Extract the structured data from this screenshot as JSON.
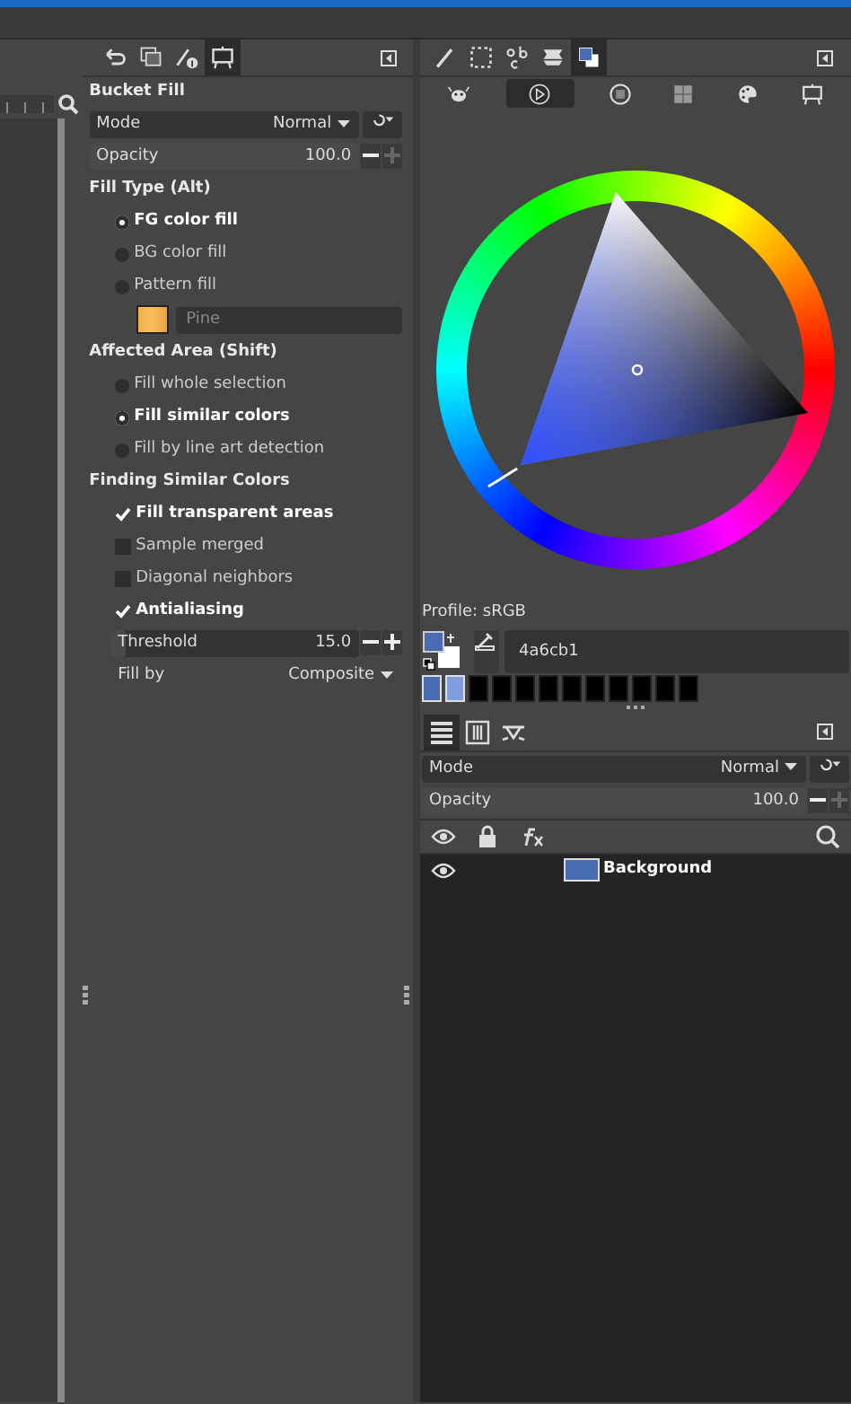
{
  "left_dock": {
    "tabs": [
      {
        "kind": "undo",
        "selected": false
      },
      {
        "kind": "images",
        "selected": false
      },
      {
        "kind": "pointer",
        "selected": false
      },
      {
        "kind": "device",
        "selected": true
      }
    ]
  },
  "tool_options": {
    "title": "Bucket Fill",
    "mode": {
      "label": "Mode",
      "value": "Normal"
    },
    "opacity": {
      "label": "Opacity",
      "value": "100.0",
      "level": 1
    },
    "fill_type": {
      "title": "Fill Type  (Alt)",
      "options": [
        {
          "label": "FG color fill",
          "selected": true
        },
        {
          "label": "BG color fill",
          "selected": false
        },
        {
          "label": "Pattern fill",
          "selected": false
        }
      ]
    },
    "pattern": {
      "name": "Pine"
    },
    "affected_area": {
      "title": "Affected Area  (Shift)",
      "options": [
        {
          "label": "Fill whole selection",
          "selected": false
        },
        {
          "label": "Fill similar colors",
          "selected": true
        },
        {
          "label": "Fill by line art detection",
          "selected": false
        }
      ]
    },
    "similar_colors": {
      "title": "Finding Similar Colors",
      "checks": [
        {
          "label": "Fill transparent areas",
          "checked": true
        },
        {
          "label": "Sample merged",
          "checked": false
        },
        {
          "label": "Diagonal neighbors",
          "checked": false
        },
        {
          "label": "Antialiasing",
          "checked": true
        }
      ]
    },
    "threshold": {
      "label": "Threshold",
      "value": "15.0",
      "level": 0.06
    },
    "fill_by": {
      "label": "Fill by",
      "value": "Composite"
    }
  },
  "right_dock": {
    "tabs": [
      {
        "kind": "brush",
        "selected": false
      },
      {
        "kind": "selection",
        "selected": false
      },
      {
        "kind": "fonts",
        "selected": false
      },
      {
        "kind": "patterns",
        "selected": false
      },
      {
        "kind": "colors",
        "selected": true
      }
    ],
    "color_tabs": [
      {
        "kind": "gimp",
        "selected": false
      },
      {
        "kind": "wheel",
        "selected": true
      },
      {
        "kind": "scales",
        "selected": false
      },
      {
        "kind": "cmyk",
        "selected": false
      },
      {
        "kind": "palette",
        "selected": false
      },
      {
        "kind": "device",
        "selected": false
      }
    ],
    "profile": "Profile: sRGB",
    "hex": "4a6cb1",
    "history": [
      {
        "color": "#4a6cb1"
      },
      {
        "color": "#7f9ee0"
      },
      {
        "color": "#000000"
      },
      {
        "color": "#000000"
      },
      {
        "color": "#000000"
      },
      {
        "color": "#000000"
      },
      {
        "color": "#000000"
      },
      {
        "color": "#000000"
      },
      {
        "color": "#000000"
      },
      {
        "color": "#000000"
      },
      {
        "color": "#000000"
      },
      {
        "color": "#000000"
      }
    ]
  },
  "layers_dock": {
    "tabs": [
      {
        "kind": "layers",
        "selected": true
      },
      {
        "kind": "channels",
        "selected": false
      },
      {
        "kind": "paths",
        "selected": false
      }
    ],
    "mode": {
      "label": "Mode",
      "value": "Normal"
    },
    "opacity": {
      "label": "Opacity",
      "value": "100.0",
      "level": 1
    },
    "layers": [
      {
        "name": "Background",
        "visible": true,
        "color": "#4a6cb1"
      }
    ]
  }
}
